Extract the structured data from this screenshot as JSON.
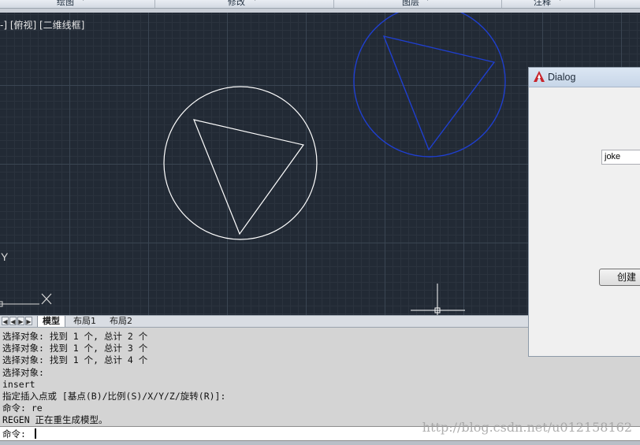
{
  "ribbon": {
    "panels": [
      "绘图",
      "修改",
      "图层",
      "注释"
    ]
  },
  "viewport": {
    "view_label": "-] [俯视] [二维线框]",
    "ucs_y_label": "Y",
    "ucs_x_label": "X"
  },
  "layout_tabs": {
    "tabs": [
      "模型",
      "布局1",
      "布局2"
    ],
    "active": "模型"
  },
  "command": {
    "history": [
      "选择对象: 找到 1 个, 总计 2 个",
      "选择对象: 找到 1 个, 总计 3 个",
      "选择对象: 找到 1 个, 总计 4 个",
      "选择对象:",
      "insert",
      "指定插入点或 [基点(B)/比例(S)/X/Y/Z/旋转(R)]:",
      "命令: re",
      "REGEN 正在重生成模型。"
    ],
    "prompt": "命令:",
    "input_value": ""
  },
  "watermark": "http://blog.csdn.net/u012158162",
  "dialog": {
    "title": "Dialog",
    "text_value": "joke",
    "create_button_label": "创建"
  },
  "colors": {
    "viewport_bg": "#222a35",
    "white_shapes": "#ffffff",
    "selected_shapes": "#1f3fd0",
    "dialog_bg": "#f0f0f0"
  }
}
